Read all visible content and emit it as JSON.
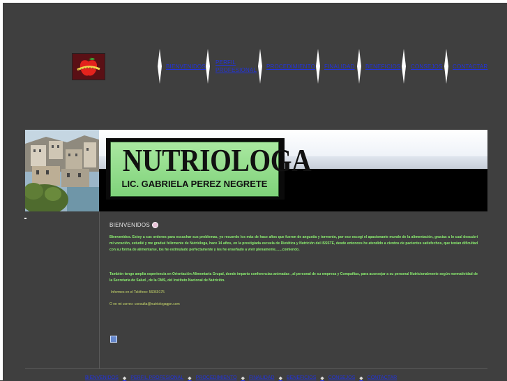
{
  "logo": {
    "icon": "apple-tape-measure-icon"
  },
  "nav": {
    "items": [
      {
        "label": "BIENVENIDOS"
      },
      {
        "label": "PERFIL PROFESIONAL"
      },
      {
        "label": "PROCEDIMIENTO"
      },
      {
        "label": "FINALIDAD"
      },
      {
        "label": "BENEFICIOS"
      },
      {
        "label": "CONSEJOS"
      },
      {
        "label": "CONTACTAR"
      }
    ]
  },
  "header": {
    "title": "NUTRIOLOGA",
    "subtitle": "LIC. GABRIELA PEREZ NEGRETE"
  },
  "content": {
    "heading": "BIENVENIDOS",
    "p1": "Bienvenidos. Estoy a sus ordenes para escuchar sus problemas, yo recuerdo los más de hace años que fueron de angustia y tormento, por eso escogí el apasionante mundo de la alimentación, gracias a lo cual descubrí mi vocación, estudié y me gradué felizmente de Nutrióloga, hace 14 años, en la prestigiada escuela de Dietética y Nutrición del ISSSTE, desde entonces he atendido a cientos de pacientes satisfechos, que tenían dificultad con su forma de alimentarse, los he estimulado perfectamente y les he enseñado a vivir plenamente.......comiendo.",
    "p2": "También tengo amplia experiencia en Orientación Alimentaria Grupal, donde imparto conferencias animadas , al personal de su empresa y Compañías, para aconsejar a su personal Nutricionalmente según normatividad de la Secretaría de Salud , de la OMS, del Instituto Nacional de Nutrición.",
    "phone": "Informes en el Teléfono: 56069175",
    "email": "O en mi correo: consulta@nutriologagpn.com"
  },
  "footer": {
    "items": [
      "BIENVENIDOS",
      "PERFIL PROFESIONAL",
      "PROCEDIMIENTO",
      "FINALIDAD",
      "BENEFICIOS",
      "CONSEJOS",
      "CONTACTAR"
    ]
  }
}
